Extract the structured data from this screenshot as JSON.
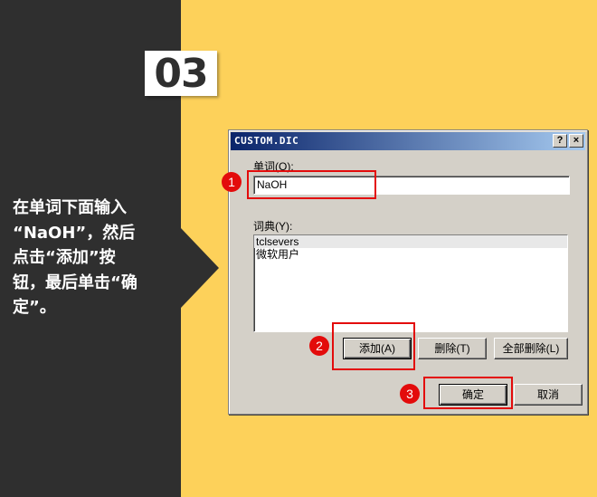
{
  "step": {
    "number": "03"
  },
  "instruction": "在单词下面输入\n“NaOH”，然后\n点击“添加”按\n钮，最后单击“确\n定”。",
  "dialog": {
    "title": "CUSTOM.DIC",
    "help_label": "?",
    "close_label": "×",
    "word_label": "单词(O):",
    "word_value": "NaOH",
    "dict_label": "词典(Y):",
    "dict_items": [
      "tclsevers",
      "微软用户"
    ],
    "add_label": "添加(A)",
    "delete_label": "删除(T)",
    "delete_all_label": "全部删除(L)",
    "ok_label": "确定",
    "cancel_label": "取消"
  },
  "callouts": [
    "1",
    "2",
    "3"
  ],
  "colors": {
    "dark_panel": "#2f2f2f",
    "background": "#fdd15a",
    "callout": "#e30b0b"
  }
}
